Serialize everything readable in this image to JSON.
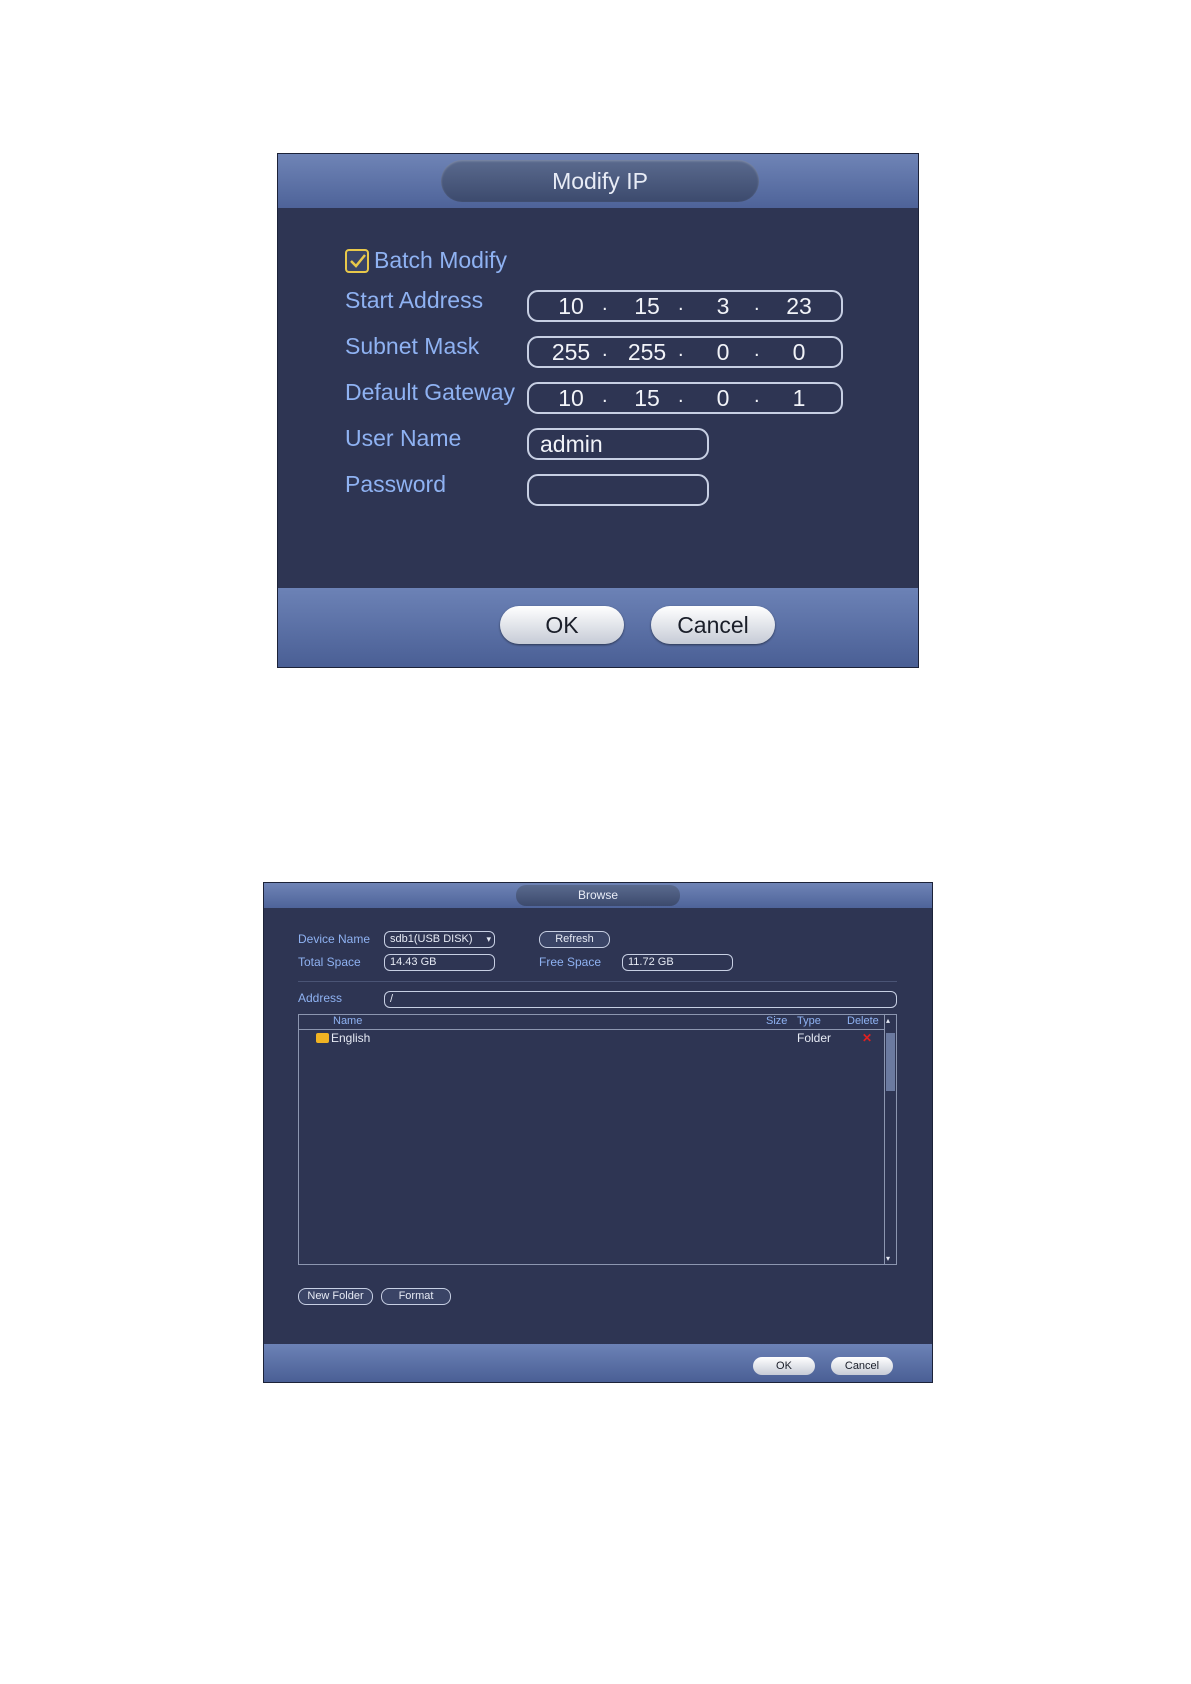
{
  "modify_ip": {
    "title": "Modify IP",
    "batch_modify": {
      "label": "Batch Modify",
      "checked": true
    },
    "start_address": {
      "label": "Start Address",
      "octets": [
        "10",
        "15",
        "3",
        "23"
      ]
    },
    "subnet_mask": {
      "label": "Subnet Mask",
      "octets": [
        "255",
        "255",
        "0",
        "0"
      ]
    },
    "default_gateway": {
      "label": "Default Gateway",
      "octets": [
        "10",
        "15",
        "0",
        "1"
      ]
    },
    "user_name": {
      "label": "User Name",
      "value": "admin"
    },
    "password": {
      "label": "Password",
      "value": ""
    },
    "ok_label": "OK",
    "cancel_label": "Cancel"
  },
  "browse": {
    "title": "Browse",
    "device_name": {
      "label": "Device Name",
      "value": "sdb1(USB DISK)"
    },
    "refresh_label": "Refresh",
    "total_space": {
      "label": "Total Space",
      "value": "14.43 GB"
    },
    "free_space": {
      "label": "Free Space",
      "value": "11.72 GB"
    },
    "address": {
      "label": "Address",
      "value": "/"
    },
    "columns": {
      "name": "Name",
      "size": "Size",
      "type": "Type",
      "delete": "Delete"
    },
    "rows": [
      {
        "name": "English",
        "size": "",
        "type": "Folder",
        "icon": "folder-icon"
      }
    ],
    "new_folder_label": "New Folder",
    "format_label": "Format",
    "ok_label": "OK",
    "cancel_label": "Cancel"
  },
  "colors": {
    "panel": "#2e3553",
    "bar": "#5a6fa5",
    "label": "#8fb2f2",
    "checkbox": "#e8c84a",
    "delete": "#e02020"
  }
}
